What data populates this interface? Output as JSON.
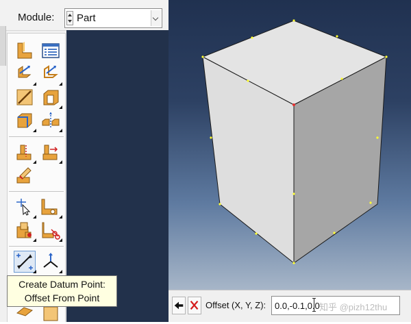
{
  "module_bar": {
    "label": "Module:",
    "selected": "Part"
  },
  "tooltip": {
    "line1": "Create Datum Point:",
    "line2": "Offset From Point"
  },
  "prompt": {
    "offset_label": "Offset (X, Y, Z):",
    "offset_value": "0.0,-0.1,0.0",
    "watermark": "知乎 @pizh12thu"
  },
  "toolbox": {
    "icons": [
      "create-part-icon",
      "part-manager-icon",
      "create-solid-extrude-icon",
      "create-shell-icon",
      "create-wire-icon",
      "create-cut-extrude-icon",
      "create-round-fillet-icon",
      "mirror-icon",
      "partition-face-icon",
      "partition-edge-icon",
      "partition-cell-icon",
      "create-datum-point-icon",
      "create-datum-axis-icon",
      "repair-icon",
      "remove-face-icon",
      "create-datum-point-offset-icon",
      "create-datum-csys-icon"
    ]
  },
  "colors": {
    "viewport_top": "#203150",
    "viewport_bottom": "#a7b6c8",
    "accent_active": "#6c9bd2",
    "tooltip_bg": "#ffffe1",
    "vertex_marker": "#ffff33",
    "selected_point": "#e53030"
  }
}
